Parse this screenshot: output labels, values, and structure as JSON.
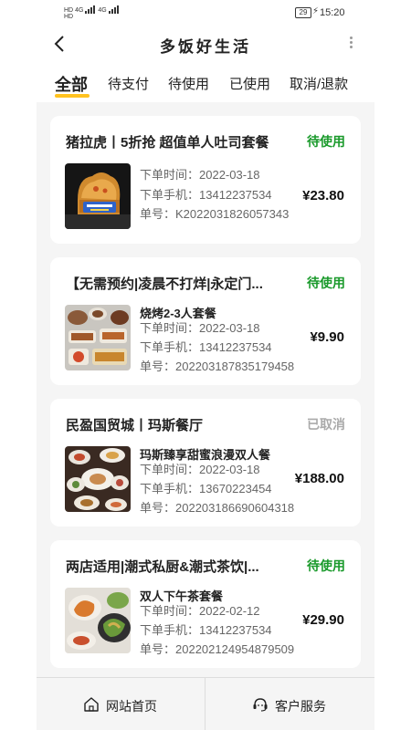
{
  "status_bar": {
    "signal_1": "HD",
    "signal_2": "HD",
    "net_1": "4G",
    "net_2": "4G",
    "battery": "29",
    "time": "15:20"
  },
  "nav": {
    "title": "多饭好生活"
  },
  "tabs": [
    {
      "label": "全部",
      "active": true
    },
    {
      "label": "待支付",
      "active": false
    },
    {
      "label": "待使用",
      "active": false
    },
    {
      "label": "已使用",
      "active": false
    },
    {
      "label": "取消/退款",
      "active": false
    }
  ],
  "orders": [
    {
      "shop": "猪拉虎丨5折抢 超值单人吐司套餐",
      "status": "待使用",
      "product": "",
      "order_time": "下单时间：2022-03-18",
      "phone": "下单手机：13412237534",
      "order_no": "单号：K2022031826057343",
      "price": "¥23.80"
    },
    {
      "shop": "【无需预约|凌晨不打烊|永定门...",
      "status": "待使用",
      "product": "烧烤2-3人套餐",
      "order_time": "下单时间：2022-03-18",
      "phone": "下单手机：13412237534",
      "order_no": "单号：202203187835179458",
      "price": "¥9.90"
    },
    {
      "shop": "民盈国贸城丨玛斯餐厅",
      "status": "已取消",
      "product": "玛斯臻享甜蜜浪漫双人餐",
      "order_time": "下单时间：2022-03-18",
      "phone": "下单手机：13670223454",
      "order_no": "单号：202203186690604318",
      "price": "¥188.00"
    },
    {
      "shop": "两店适用|潮式私厨&潮式茶饮|...",
      "status": "待使用",
      "product": "双人下午茶套餐",
      "order_time": "下单时间：2022-02-12",
      "phone": "下单手机：13412237534",
      "order_no": "单号：202202124954879509",
      "price": "¥29.90"
    }
  ],
  "bottom": {
    "home_label": "网站首页",
    "service_label": "客户服务"
  },
  "colors": {
    "accent": "#ffc21f",
    "status_green": "#1a9a2b",
    "status_grey": "#aaaaaa"
  }
}
